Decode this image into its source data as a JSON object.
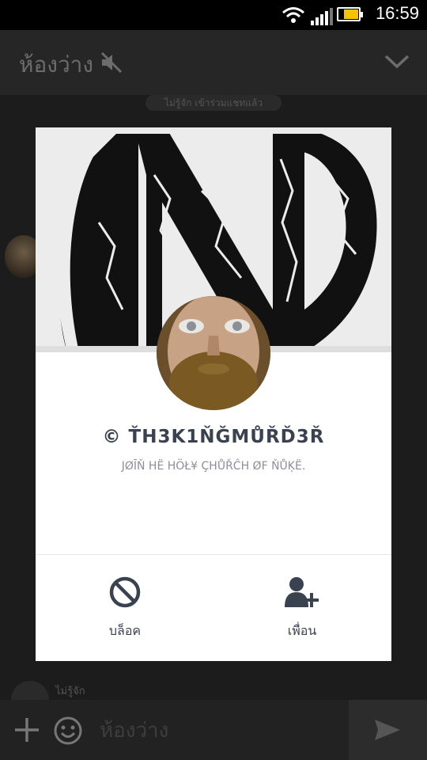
{
  "status_bar": {
    "time": "16:59",
    "battery_level": 0.7
  },
  "header": {
    "room_title": "ห้องว่าง",
    "icons": [
      "mute-icon",
      "chevron-down-icon"
    ]
  },
  "system_message": "ไม่รู้จัก เข้าร่วมแชทแล้ว",
  "chat": {
    "sender_name": "ไม่รู้จัก"
  },
  "composer": {
    "placeholder": "ห้องว่าง",
    "icons": [
      "plus-icon",
      "smiley-icon",
      "send-icon"
    ]
  },
  "profile_popup": {
    "display_name": "© ŤH3K1ŇĞMŮŘĎ3Ř",
    "status_message": "JØĪŇ  HË HÖŁ¥ ÇHŮŘĈH ØF ŇŮĶË.",
    "actions": {
      "block_label": "บล็อค",
      "add_friend_label": "เพื่อน"
    },
    "colors": {
      "accent": "#3a4250",
      "cover_bg": "#ececec"
    }
  }
}
